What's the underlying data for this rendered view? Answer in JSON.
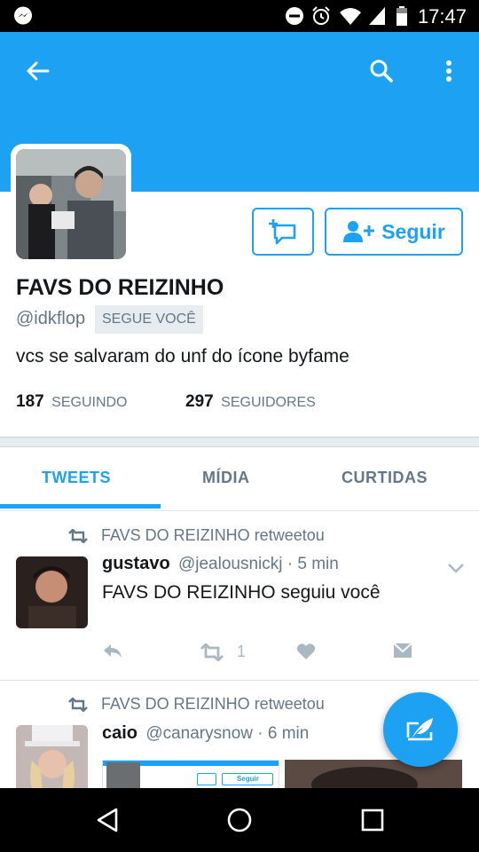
{
  "status_bar": {
    "time": "17:47"
  },
  "profile": {
    "name": "FAVS DO REIZINHO",
    "handle": "@idkflop",
    "follows_you_badge": "SEGUE VOCÊ",
    "bio": "vcs se salvaram do unf do ícone byfame",
    "following_count": "187",
    "following_label": "SEGUINDO",
    "followers_count": "297",
    "followers_label": "SEGUIDORES",
    "follow_button_label": "Seguir"
  },
  "colors": {
    "brand": "#1da1f2",
    "muted": "#657786"
  },
  "tabs": [
    {
      "label": "TWEETS",
      "active": true
    },
    {
      "label": "MÍDIA",
      "active": false
    },
    {
      "label": "CURTIDAS",
      "active": false
    }
  ],
  "tweets": [
    {
      "retweet_label": "FAVS DO REIZINHO retweetou",
      "author_name": "gustavo",
      "author_handle_time": "@jealousnickj · 5 min",
      "text": "FAVS DO REIZINHO seguiu você",
      "retweet_count": "1"
    },
    {
      "retweet_label": "FAVS DO REIZINHO retweetou",
      "author_name": "caio",
      "author_handle_time": "@canarysnow · 6 min",
      "embedded_button_label": "Seguir"
    }
  ]
}
